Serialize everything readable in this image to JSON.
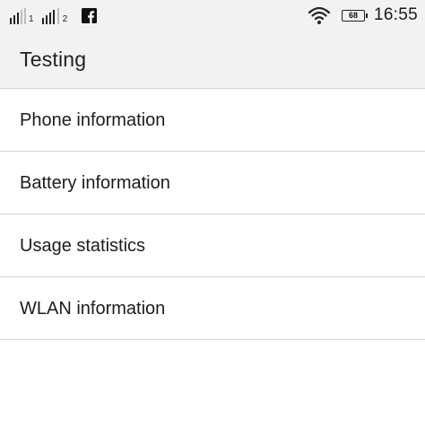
{
  "status_bar": {
    "sim1_label": "1",
    "sim2_label": "2",
    "notification_icon": "facebook-icon",
    "battery_level": "68",
    "time": "16:55"
  },
  "app_bar": {
    "title": "Testing"
  },
  "menu": {
    "items": [
      {
        "label": "Phone information"
      },
      {
        "label": "Battery information"
      },
      {
        "label": "Usage statistics"
      },
      {
        "label": "WLAN information"
      }
    ]
  },
  "colors": {
    "bar_background": "#f2f2f2",
    "divider": "#d2d2d2",
    "text": "#1c1c1c"
  }
}
